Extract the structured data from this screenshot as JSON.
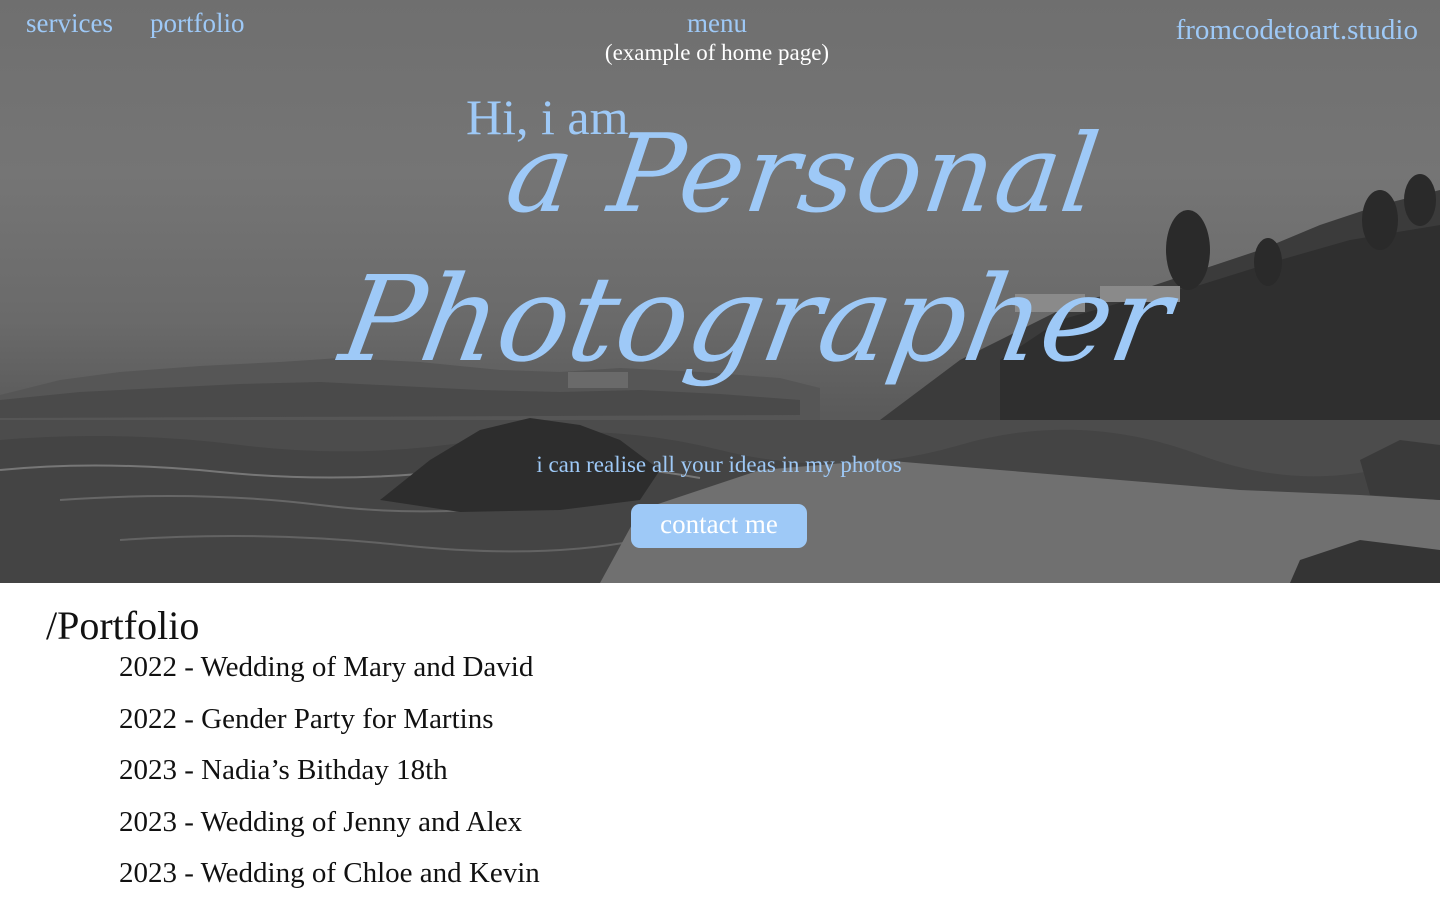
{
  "nav": {
    "services_label": "services",
    "portfolio_label": "portfolio",
    "menu_label": "menu",
    "menu_note": "(example of home page)",
    "site_name": "fromcodetoart.studio"
  },
  "hero": {
    "greeting": "Hi, i am",
    "headline_line1": "a Personal",
    "headline_line2": "Photographer",
    "tagline": "i can realise all your ideas in my photos",
    "cta_label": "contact me"
  },
  "portfolio": {
    "title": "/Portfolio",
    "items": [
      "2022 - Wedding of Mary and David",
      "2022 - Gender Party for Martins",
      "2023 - Nadia’s Bithday 18th",
      "2023 - Wedding of Jenny and Alex",
      "2023 - Wedding of Chloe and Kevin"
    ]
  },
  "colors": {
    "accent": "#9ec9f7",
    "text": "#111111",
    "background": "#ffffff"
  }
}
